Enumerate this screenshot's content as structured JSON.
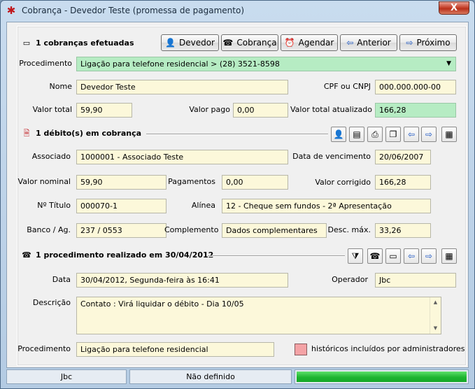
{
  "window": {
    "title": "Cobrança - Devedor Teste (promessa de pagamento)",
    "close_glyph": "X"
  },
  "header": {
    "title": "1 cobranças efetuadas",
    "buttons": {
      "devedor": "Devedor",
      "cobranca": "Cobrança",
      "agendar": "Agendar",
      "anterior": "Anterior",
      "proximo": "Próximo"
    }
  },
  "cobranca": {
    "procedimento_label": "Procedimento",
    "procedimento_value": "Ligação para telefone residencial >  (28) 3521-8598",
    "nome_label": "Nome",
    "nome_value": "Devedor Teste",
    "cpf_label": "CPF ou CNPJ",
    "cpf_value": "000.000.000-00",
    "valor_total_label": "Valor total",
    "valor_total_value": "59,90",
    "valor_pago_label": "Valor pago",
    "valor_pago_value": "0,00",
    "valor_atualizado_label": "Valor total atualizado",
    "valor_atualizado_value": "166,28"
  },
  "debito": {
    "title": "1 débito(s) em cobrança",
    "associado_label": "Associado",
    "associado_value": "1000001 - Associado Teste",
    "vencimento_label": "Data de vencimento",
    "vencimento_value": "20/06/2007",
    "valor_nominal_label": "Valor nominal",
    "valor_nominal_value": "59,90",
    "pagamentos_label": "Pagamentos",
    "pagamentos_value": "0,00",
    "valor_corrigido_label": "Valor corrigido",
    "valor_corrigido_value": "166,28",
    "titulo_label": "Nº Título",
    "titulo_value": "000070-1",
    "alinea_label": "Alínea",
    "alinea_value": "12 - Cheque sem fundos - 2ª Apresentação",
    "banco_label": "Banco / Ag.",
    "banco_value": "237   /  0553",
    "complemento_label": "Complemento",
    "complemento_value": "Dados complementares",
    "desc_label": "Desc. máx.",
    "desc_value": "33,26"
  },
  "procedimento": {
    "title": "1 procedimento realizado em 30/04/2012",
    "data_label": "Data",
    "data_value": "30/04/2012, Segunda-feira às 16:41",
    "operador_label": "Operador",
    "operador_value": "Jbc",
    "descricao_label": "Descrição",
    "descricao_value": "Contato : Virá liquidar o débito - Dia 10/05",
    "procedimento_label": "Procedimento",
    "procedimento_value": "Ligação para telefone residencial",
    "legend_label": "históricos incluídos por administradores"
  },
  "status": {
    "user": "Jbc",
    "state": "Não definido",
    "progress": 1.0
  },
  "colors": {
    "field_bg": "#fcf8da",
    "highlight_bg": "#b6ecc3",
    "admin_swatch": "#f4a3a6",
    "progress_fill": "#1eb531"
  }
}
